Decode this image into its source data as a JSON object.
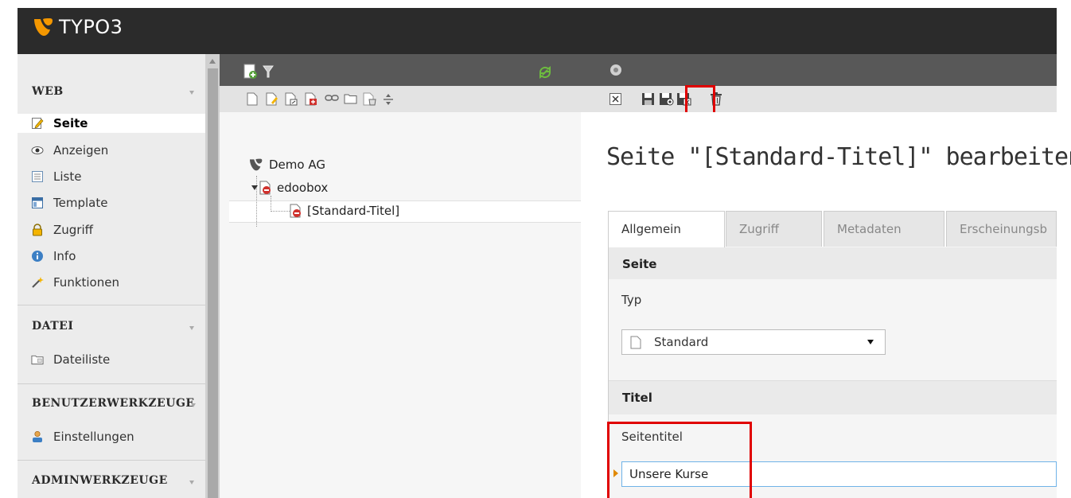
{
  "app": {
    "brand": "TYPO3",
    "colors": {
      "topbar": "#2b2b2b",
      "accent": "#f49700",
      "highlight": "#e00000",
      "page_icon_red": "#d0312d"
    }
  },
  "module_menu": {
    "groups": [
      {
        "label": "WEB",
        "items": [
          {
            "label": "Seite",
            "icon": "page-edit-icon",
            "active": true
          },
          {
            "label": "Anzeigen",
            "icon": "eye-icon"
          },
          {
            "label": "Liste",
            "icon": "list-icon"
          },
          {
            "label": "Template",
            "icon": "template-icon"
          },
          {
            "label": "Zugriff",
            "icon": "lock-icon"
          },
          {
            "label": "Info",
            "icon": "info-icon"
          },
          {
            "label": "Funktionen",
            "icon": "wand-icon"
          }
        ]
      },
      {
        "label": "DATEI",
        "items": [
          {
            "label": "Dateiliste",
            "icon": "folder-icon"
          }
        ]
      },
      {
        "label": "BENUTZERWERKZEUGE",
        "items": [
          {
            "label": "Einstellungen",
            "icon": "user-settings-icon"
          }
        ]
      },
      {
        "label": "ADMINWERKZEUGE",
        "items": []
      }
    ]
  },
  "page_tree": {
    "toolbar_icons": [
      "new-page-icon",
      "filter-icon",
      "refresh-icon"
    ],
    "doktype_icons": [
      "page-standard-icon",
      "page-backend-section-icon",
      "page-shortcut-icon",
      "page-mountpoint-icon",
      "page-link-icon",
      "folder-icon",
      "recycler-icon",
      "spacer-icon"
    ],
    "nodes": [
      {
        "label": "Demo AG",
        "icon": "typo3-root-icon"
      },
      {
        "label": "edoobox",
        "icon": "page-hidden-icon"
      },
      {
        "label": "[Standard-Titel]",
        "icon": "page-hidden-icon"
      }
    ]
  },
  "document": {
    "toolbar_icons": [
      "close-icon",
      "save-icon",
      "save-and-view-icon",
      "save-and-close-icon",
      "delete-icon"
    ],
    "title": "Seite \"[Standard-Titel]\" bearbeiten",
    "tabs": [
      {
        "label": "Allgemein",
        "active": true
      },
      {
        "label": "Zugriff"
      },
      {
        "label": "Metadaten"
      },
      {
        "label": "Erscheinungsb"
      }
    ],
    "section_seite": "Seite",
    "typ_label": "Typ",
    "typ_value": "Standard",
    "section_titel": "Titel",
    "seitentitel_label": "Seitentitel",
    "seitentitel_value": "Unsere Kurse"
  }
}
